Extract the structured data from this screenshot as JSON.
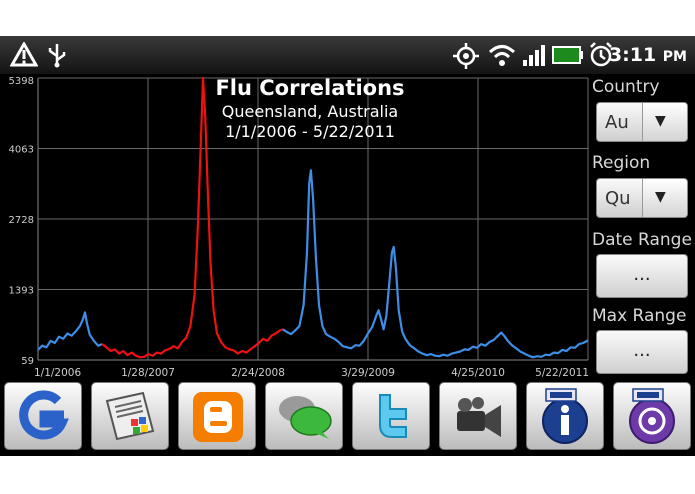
{
  "status_bar": {
    "time": "3:11",
    "ampm": "PM",
    "icons": [
      "warning-icon",
      "usb-icon",
      "gps-icon",
      "wifi-icon",
      "signal-icon",
      "battery-icon",
      "alarm-icon"
    ]
  },
  "panel": {
    "country_label": "Country",
    "country_value": "Au",
    "region_label": "Region",
    "region_value": "Qu",
    "date_range_label": "Date Range",
    "date_range_button": "...",
    "max_range_label": "Max Range",
    "max_range_button": "..."
  },
  "dock": [
    {
      "name": "google",
      "icon": "google-icon"
    },
    {
      "name": "news",
      "icon": "newspaper-icon"
    },
    {
      "name": "blogger",
      "icon": "blogger-icon"
    },
    {
      "name": "chat",
      "icon": "chat-bubbles-icon"
    },
    {
      "name": "twitter",
      "icon": "twitter-icon"
    },
    {
      "name": "video",
      "icon": "video-camera-icon"
    },
    {
      "name": "cdc-info",
      "icon": "cdc-info-icon"
    },
    {
      "name": "cdc-podcast",
      "icon": "cdc-podcast-icon"
    }
  ],
  "colors": {
    "highlight": "#ee1111",
    "series": "#3d8ee6",
    "grid": "#6a6a6a",
    "background": "#000000"
  },
  "chart_data": {
    "type": "line",
    "title": "Flu Correlations",
    "subtitle": "Queensland, Australia",
    "date_range": "1/1/2006 - 5/22/2011",
    "ylim": [
      59,
      5398
    ],
    "y_ticks": [
      59,
      1393,
      2728,
      4063,
      5398
    ],
    "x_tick_labels": [
      "1/1/2006",
      "1/28/2007",
      "2/24/2008",
      "3/29/2009",
      "4/25/2010",
      "5/22/2011"
    ],
    "x_range": [
      0,
      1967
    ],
    "highlight_range": [
      238,
      875
    ],
    "points": [
      [
        0,
        250
      ],
      [
        15,
        330
      ],
      [
        30,
        300
      ],
      [
        45,
        420
      ],
      [
        60,
        380
      ],
      [
        75,
        500
      ],
      [
        90,
        460
      ],
      [
        105,
        560
      ],
      [
        120,
        520
      ],
      [
        135,
        600
      ],
      [
        150,
        700
      ],
      [
        160,
        820
      ],
      [
        168,
        960
      ],
      [
        175,
        760
      ],
      [
        185,
        540
      ],
      [
        200,
        420
      ],
      [
        215,
        330
      ],
      [
        230,
        360
      ],
      [
        245,
        300
      ],
      [
        260,
        230
      ],
      [
        275,
        260
      ],
      [
        290,
        180
      ],
      [
        305,
        230
      ],
      [
        320,
        150
      ],
      [
        335,
        200
      ],
      [
        350,
        140
      ],
      [
        365,
        110
      ],
      [
        380,
        120
      ],
      [
        395,
        170
      ],
      [
        410,
        140
      ],
      [
        425,
        200
      ],
      [
        440,
        180
      ],
      [
        455,
        240
      ],
      [
        470,
        270
      ],
      [
        485,
        320
      ],
      [
        500,
        280
      ],
      [
        515,
        400
      ],
      [
        530,
        480
      ],
      [
        545,
        700
      ],
      [
        560,
        1300
      ],
      [
        572,
        2600
      ],
      [
        582,
        4100
      ],
      [
        590,
        5398
      ],
      [
        598,
        4700
      ],
      [
        607,
        3300
      ],
      [
        617,
        1900
      ],
      [
        628,
        1000
      ],
      [
        640,
        560
      ],
      [
        655,
        400
      ],
      [
        670,
        300
      ],
      [
        685,
        260
      ],
      [
        700,
        240
      ],
      [
        715,
        180
      ],
      [
        730,
        230
      ],
      [
        745,
        200
      ],
      [
        760,
        260
      ],
      [
        775,
        320
      ],
      [
        790,
        380
      ],
      [
        805,
        460
      ],
      [
        820,
        420
      ],
      [
        835,
        520
      ],
      [
        850,
        560
      ],
      [
        865,
        620
      ],
      [
        875,
        640
      ],
      [
        890,
        590
      ],
      [
        905,
        550
      ],
      [
        920,
        620
      ],
      [
        935,
        700
      ],
      [
        950,
        1100
      ],
      [
        962,
        2100
      ],
      [
        970,
        3400
      ],
      [
        976,
        3650
      ],
      [
        984,
        3100
      ],
      [
        994,
        2000
      ],
      [
        1005,
        1100
      ],
      [
        1017,
        700
      ],
      [
        1030,
        550
      ],
      [
        1045,
        500
      ],
      [
        1060,
        460
      ],
      [
        1075,
        400
      ],
      [
        1090,
        320
      ],
      [
        1105,
        300
      ],
      [
        1120,
        280
      ],
      [
        1135,
        340
      ],
      [
        1150,
        330
      ],
      [
        1165,
        420
      ],
      [
        1180,
        560
      ],
      [
        1195,
        680
      ],
      [
        1210,
        900
      ],
      [
        1218,
        1000
      ],
      [
        1226,
        850
      ],
      [
        1236,
        640
      ],
      [
        1246,
        900
      ],
      [
        1256,
        1500
      ],
      [
        1266,
        2100
      ],
      [
        1272,
        2200
      ],
      [
        1280,
        1800
      ],
      [
        1290,
        1000
      ],
      [
        1302,
        600
      ],
      [
        1315,
        450
      ],
      [
        1330,
        340
      ],
      [
        1345,
        280
      ],
      [
        1360,
        220
      ],
      [
        1375,
        180
      ],
      [
        1390,
        150
      ],
      [
        1405,
        170
      ],
      [
        1420,
        140
      ],
      [
        1435,
        130
      ],
      [
        1450,
        160
      ],
      [
        1465,
        140
      ],
      [
        1480,
        180
      ],
      [
        1495,
        200
      ],
      [
        1510,
        220
      ],
      [
        1525,
        260
      ],
      [
        1540,
        250
      ],
      [
        1555,
        310
      ],
      [
        1570,
        290
      ],
      [
        1585,
        360
      ],
      [
        1600,
        330
      ],
      [
        1615,
        400
      ],
      [
        1630,
        440
      ],
      [
        1645,
        520
      ],
      [
        1657,
        580
      ],
      [
        1667,
        520
      ],
      [
        1680,
        420
      ],
      [
        1695,
        340
      ],
      [
        1710,
        280
      ],
      [
        1725,
        220
      ],
      [
        1740,
        180
      ],
      [
        1755,
        140
      ],
      [
        1770,
        110
      ],
      [
        1785,
        130
      ],
      [
        1800,
        120
      ],
      [
        1815,
        160
      ],
      [
        1830,
        150
      ],
      [
        1845,
        200
      ],
      [
        1860,
        190
      ],
      [
        1875,
        250
      ],
      [
        1890,
        230
      ],
      [
        1905,
        300
      ],
      [
        1920,
        290
      ],
      [
        1935,
        360
      ],
      [
        1950,
        380
      ],
      [
        1967,
        430
      ]
    ]
  }
}
